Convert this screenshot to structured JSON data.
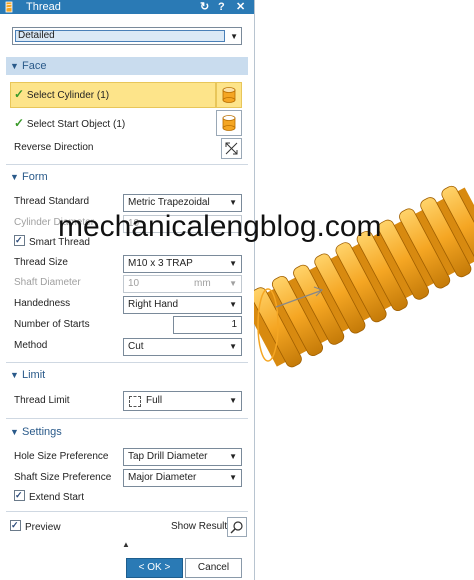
{
  "title": "Thread",
  "title_buttons": {
    "reset": "↻",
    "help": "?",
    "close": "✕"
  },
  "thread_type": "Detailed",
  "face": {
    "section": "Face",
    "select_cylinder": "Select Cylinder (1)",
    "select_start": "Select Start Object (1)",
    "reverse_direction": "Reverse Direction"
  },
  "form": {
    "section": "Form",
    "thread_standard_label": "Thread Standard",
    "thread_standard_value": "Metric Trapezoidal",
    "cylinder_diameter_label": "Cylinder Diameter",
    "cylinder_diameter_value": "10",
    "smart_thread": "Smart Thread",
    "thread_size_label": "Thread Size",
    "thread_size_value": "M10 x 3 TRAP",
    "shaft_diameter_label": "Shaft Diameter",
    "shaft_diameter_value": "10",
    "shaft_diameter_unit": "mm",
    "handedness_label": "Handedness",
    "handedness_value": "Right Hand",
    "starts_label": "Number of Starts",
    "starts_value": "1",
    "method_label": "Method",
    "method_value": "Cut"
  },
  "limit": {
    "section": "Limit",
    "thread_limit_label": "Thread Limit",
    "thread_limit_value": "Full"
  },
  "settings": {
    "section": "Settings",
    "hole_pref_label": "Hole Size Preference",
    "hole_pref_value": "Tap Drill Diameter",
    "shaft_pref_label": "Shaft Size Preference",
    "shaft_pref_value": "Major Diameter",
    "extend_start": "Extend Start"
  },
  "footer": {
    "preview": "Preview",
    "show_result": "Show Result",
    "ok": "< OK >",
    "cancel": "Cancel"
  },
  "watermark": "mechanicalengblog.com",
  "colors": {
    "title_bar": "#2a7ab5",
    "selected_row": "#fde48a",
    "thread_orange": "#f5a623"
  }
}
